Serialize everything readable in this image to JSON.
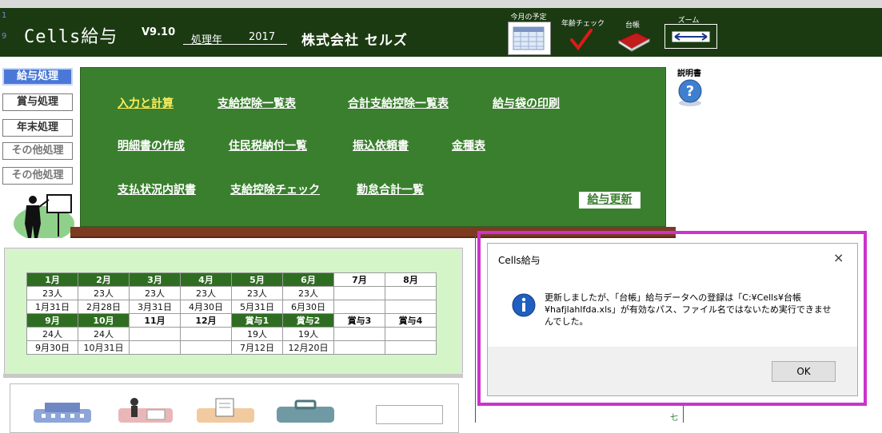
{
  "header": {
    "row_numbers": [
      "1",
      "9"
    ],
    "app_title": "Cells給与",
    "version": "V9.10",
    "year_label": "処理年",
    "year_value": "2017",
    "company": "株式会社 セルズ",
    "icons": [
      {
        "label": "今月の予定",
        "icon": "calendar-icon"
      },
      {
        "label": "年齢チェック",
        "icon": "checkmark-icon"
      },
      {
        "label": "台帳",
        "icon": "ledger-book-icon"
      },
      {
        "label": "ズーム",
        "icon": "zoom-arrows-icon"
      }
    ]
  },
  "nav": {
    "items": [
      {
        "label": "給与処理",
        "active": true
      },
      {
        "label": "賞与処理",
        "active": false
      },
      {
        "label": "年末処理",
        "active": false
      },
      {
        "label": "その他処理",
        "active": false
      },
      {
        "label": "その他処理",
        "active": false
      }
    ]
  },
  "manual": {
    "label": "説明書",
    "icon": "help-question-icon"
  },
  "panel": {
    "links": [
      "入力と計算",
      "支給控除一覧表",
      "合計支給控除一覧表",
      "給与袋の印刷",
      "明細書の作成",
      "住民税納付一覧",
      "振込依頼書",
      "金種表",
      "支払状況内訳書",
      "支給控除チェック",
      "勤怠合計一覧"
    ],
    "update_button": "給与更新"
  },
  "calendar": {
    "row1_months": [
      "1月",
      "2月",
      "3月",
      "4月",
      "5月",
      "6月",
      "7月",
      "8月"
    ],
    "row1_counts": [
      "23人",
      "23人",
      "23人",
      "23人",
      "23人",
      "23人",
      "",
      ""
    ],
    "row1_dates": [
      "1月31日",
      "2月28日",
      "3月31日",
      "4月30日",
      "5月31日",
      "6月30日",
      "",
      ""
    ],
    "row2_months": [
      "9月",
      "10月",
      "11月",
      "12月",
      "賞与1",
      "賞与2",
      "賞与3",
      "賞与4"
    ],
    "row2_counts": [
      "24人",
      "24人",
      "",
      "",
      "19人",
      "19人",
      "",
      ""
    ],
    "row2_dates": [
      "9月30日",
      "10月31日",
      "",
      "",
      "7月12日",
      "12月20日",
      "",
      ""
    ]
  },
  "dialog": {
    "title": "Cells給与",
    "close": "×",
    "message": "更新しましたが、「台帳」給与データへの登録は「C:¥Cells¥台帳¥hafjlahlfda.xls」が有効なパス、ファイル名ではないため実行できませんでした。",
    "ok_label": "OK",
    "icon": "info-icon"
  },
  "sheet_mark": "七",
  "colors": {
    "header_bg": "#1b3a12",
    "panel_green": "#3a7f2e",
    "nav_active": "#4b78d8",
    "highlight": "#cc33cc",
    "calendar_bg": "#d4f5c8"
  }
}
